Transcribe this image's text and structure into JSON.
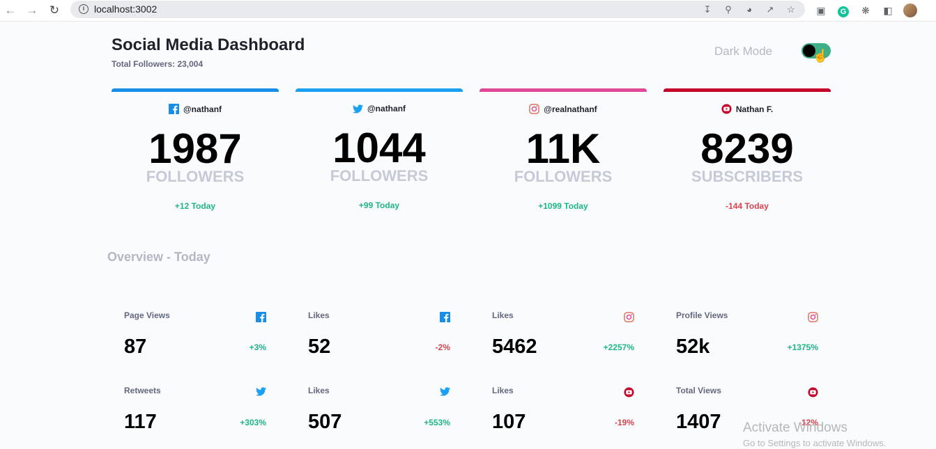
{
  "browser": {
    "url": "localhost:3002"
  },
  "header": {
    "title": "Social Media Dashboard",
    "total_followers": "Total Followers: 23,004",
    "dark_mode_label": "Dark Mode"
  },
  "cards": [
    {
      "platform": "facebook",
      "handle": "@nathanf",
      "count": "1987",
      "unit": "FOLLOWERS",
      "delta": "+12 Today",
      "trend": "up",
      "color": "#178fe6"
    },
    {
      "platform": "twitter",
      "handle": "@nathanf",
      "count": "1044",
      "unit": "FOLLOWERS",
      "delta": "+99 Today",
      "trend": "up",
      "color": "#1ca0f2"
    },
    {
      "platform": "instagram",
      "handle": "@realnathanf",
      "count": "11K",
      "unit": "FOLLOWERS",
      "delta": "+1099 Today",
      "trend": "up",
      "color": "#df4996"
    },
    {
      "platform": "youtube",
      "handle": "Nathan F.",
      "count": "8239",
      "unit": "SUBSCRIBERS",
      "delta": "-144 Today",
      "trend": "down",
      "color": "#c4032a"
    }
  ],
  "overview": {
    "title": "Overview - Today",
    "items": [
      {
        "label": "Page Views",
        "platform": "facebook",
        "value": "87",
        "pct": "+3%",
        "trend": "up"
      },
      {
        "label": "Likes",
        "platform": "facebook",
        "value": "52",
        "pct": "-2%",
        "trend": "down"
      },
      {
        "label": "Likes",
        "platform": "instagram",
        "value": "5462",
        "pct": "+2257%",
        "trend": "up"
      },
      {
        "label": "Profile Views",
        "platform": "instagram",
        "value": "52k",
        "pct": "+1375%",
        "trend": "up"
      },
      {
        "label": "Retweets",
        "platform": "twitter",
        "value": "117",
        "pct": "+303%",
        "trend": "up"
      },
      {
        "label": "Likes",
        "platform": "twitter",
        "value": "507",
        "pct": "+553%",
        "trend": "up"
      },
      {
        "label": "Likes",
        "platform": "youtube",
        "value": "107",
        "pct": "-19%",
        "trend": "down"
      },
      {
        "label": "Total Views",
        "platform": "youtube",
        "value": "1407",
        "pct": "-12%",
        "trend": "down"
      }
    ]
  },
  "watermark": {
    "line1": "Activate Windows",
    "line2": "Go to Settings to activate Windows."
  }
}
